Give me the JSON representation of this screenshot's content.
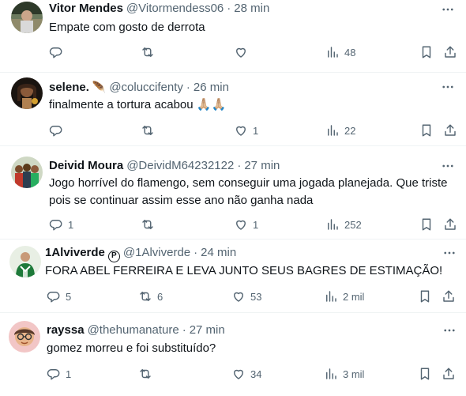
{
  "tweets": [
    {
      "name": "Vitor Mendes",
      "handle": "@Vitormendess06",
      "separator": "·",
      "time": "28 min",
      "text": [
        "Empate com gosto de derrota"
      ],
      "replies": "",
      "retweets": "",
      "likes": "",
      "views": "48"
    },
    {
      "name": "selene.",
      "name_emoji": "🪶",
      "handle": "@coluccifenty",
      "separator": "·",
      "time": "26 min",
      "text": [
        "finalmente a tortura acabou 🙏🏼🙏🏼"
      ],
      "replies": "",
      "retweets": "",
      "likes": "1",
      "views": "22"
    },
    {
      "name": "Deivid Moura",
      "handle": "@DeividM64232122",
      "separator": "·",
      "time": "27 min",
      "text": [
        "Jogo horrível do flamengo, sem conseguir uma jogada planejada. Que triste",
        "pois se continuar assim esse ano não ganha nada"
      ],
      "replies": "1",
      "retweets": "",
      "likes": "1",
      "views": "252"
    },
    {
      "name": "1Alviverde",
      "badge": "P",
      "handle": "@1Alviverde",
      "separator": "·",
      "time": "24 min",
      "text": [
        "FORA ABEL FERREIRA E LEVA JUNTO SEUS BAGRES DE ESTIMAÇÃO!"
      ],
      "replies": "5",
      "retweets": "6",
      "likes": "53",
      "views": "2 mil"
    },
    {
      "name": "rayssa",
      "handle": "@thehumanature",
      "separator": "·",
      "time": "27 min",
      "text": [
        "gomez morreu e foi substituído?"
      ],
      "replies": "1",
      "retweets": "",
      "likes": "34",
      "views": "3 mil"
    }
  ],
  "icons": {
    "reply": "reply-icon",
    "retweet": "retweet-icon",
    "like": "heart-icon",
    "views": "views-icon",
    "bookmark": "bookmark-icon",
    "share": "share-icon",
    "more": "more-icon"
  },
  "colors": {
    "text": "#0f1419",
    "secondary": "#536471",
    "divider": "#eff3f4"
  }
}
